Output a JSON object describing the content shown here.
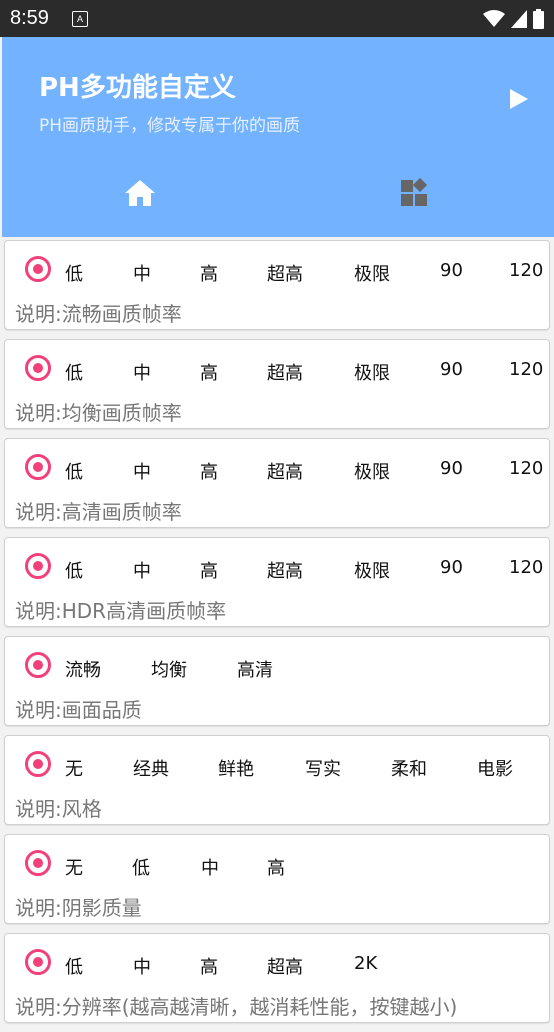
{
  "status_bar": {
    "time": "8:59",
    "notification": "A"
  },
  "header": {
    "title": "PH多功能自定义",
    "subtitle": "PH画质助手，修改专属于你的画质"
  },
  "cards": [
    {
      "options": [
        "低",
        "中",
        "高",
        "超高",
        "极限",
        "90",
        "120"
      ],
      "description": "说明:流畅画质帧率"
    },
    {
      "options": [
        "低",
        "中",
        "高",
        "超高",
        "极限",
        "90",
        "120"
      ],
      "description": "说明:均衡画质帧率"
    },
    {
      "options": [
        "低",
        "中",
        "高",
        "超高",
        "极限",
        "90",
        "120"
      ],
      "description": "说明:高清画质帧率"
    },
    {
      "options": [
        "低",
        "中",
        "高",
        "超高",
        "极限",
        "90",
        "120"
      ],
      "description": "说明:HDR高清画质帧率"
    },
    {
      "options": [
        "流畅",
        "均衡",
        "高清"
      ],
      "description": "说明:画面品质"
    },
    {
      "options": [
        "无",
        "经典",
        "鲜艳",
        "写实",
        "柔和",
        "电影"
      ],
      "description": "说明:风格"
    },
    {
      "options": [
        "无",
        "低",
        "中",
        "高"
      ],
      "description": "说明:阴影质量"
    },
    {
      "options": [
        "低",
        "中",
        "高",
        "超高",
        "2K"
      ],
      "description": "说明:分辨率(越高越清晰，越消耗性能，按键越小)"
    }
  ],
  "colors": {
    "header": "#72b2ff",
    "radio": "#f2407a"
  }
}
